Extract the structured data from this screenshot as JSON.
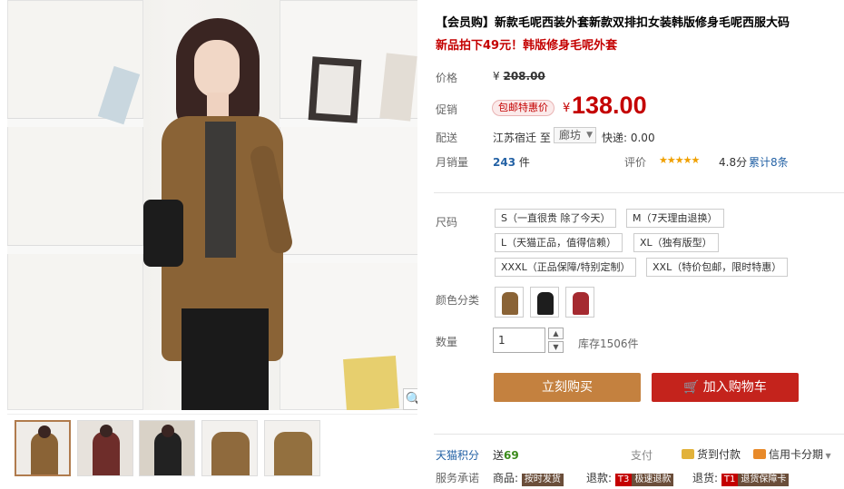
{
  "product": {
    "title": "【会员购】新款毛呢西装外套新款双排扣女装韩版修身毛呢西服大码",
    "subtitle": "新品拍下49元！韩版修身毛呢外套"
  },
  "price": {
    "label": "价格",
    "original": "208.00",
    "yen": "¥",
    "promo_label": "促销",
    "promo_tag": "包邮特惠价",
    "promo": "138.00"
  },
  "shipping": {
    "label": "配送",
    "from": "江苏宿迁  至",
    "to": "廊坊",
    "fee": "快递: 0.00"
  },
  "sales": {
    "label": "月销量",
    "count": "243",
    "unit": "件",
    "rating_label": "评价",
    "stars": "★★★★★",
    "score": "4.8分",
    "reviews": "累计8条"
  },
  "size": {
    "label": "尺码",
    "options": [
      "S（一直很贵 除了今天）",
      "M（7天理由退换）",
      "L（天猫正品，值得信赖）",
      "XL（独有版型）",
      "XXXL（正品保障/特别定制）",
      "XXL（特价包邮，限时特惠）"
    ]
  },
  "color": {
    "label": "颜色分类",
    "swatches": [
      "#8a6336",
      "#1d1d1d",
      "#a52a30"
    ]
  },
  "quantity": {
    "label": "数量",
    "value": "1",
    "stock": "库存1506件"
  },
  "actions": {
    "buy": "立刻购买",
    "cart": "加入购物车"
  },
  "footer": {
    "points_label": "天猫积分",
    "points_prefix": "送",
    "points_value": "69",
    "pay_label": "支付",
    "pay_cod": "货到付款",
    "pay_card": "信用卡分期",
    "promise_label": "服务承诺",
    "goods_label": "商品:",
    "goods_badge": "按时发货",
    "refund_label": "退款:",
    "refund_badge1": "T3",
    "refund_badge2": "极速退款",
    "return_label": "退货:",
    "return_badge1": "T1",
    "return_badge2": "退货保障卡"
  }
}
